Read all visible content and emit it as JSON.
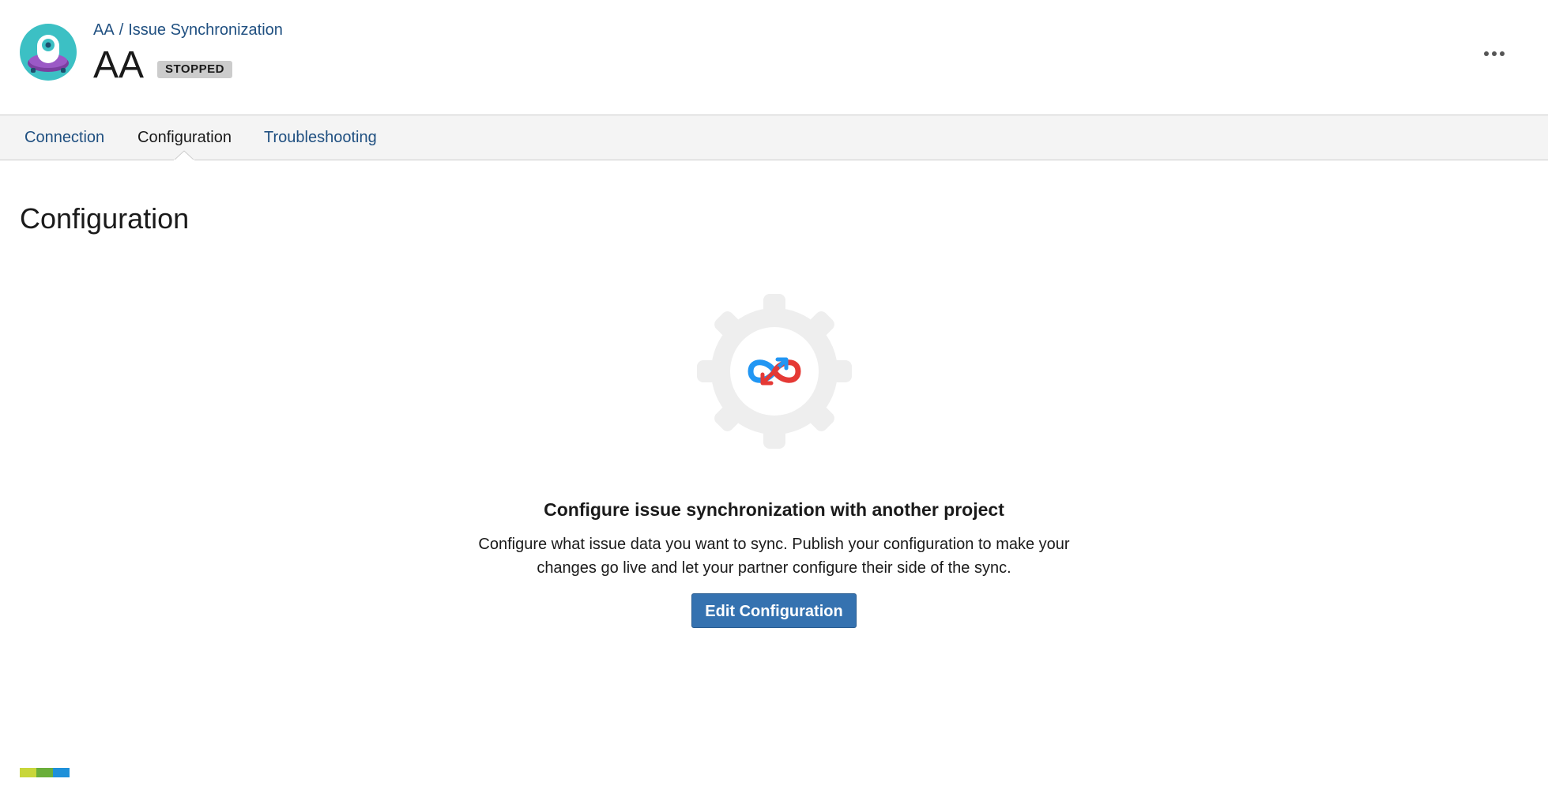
{
  "header": {
    "breadcrumb": {
      "project": "AA",
      "separator": "/",
      "section": "Issue Synchronization"
    },
    "title": "AA",
    "status": "STOPPED",
    "more_icon": "ellipsis-icon",
    "avatar_icon": "project-avatar-icon"
  },
  "tabs": [
    {
      "label": "Connection",
      "active": false
    },
    {
      "label": "Configuration",
      "active": true
    },
    {
      "label": "Troubleshooting",
      "active": false
    }
  ],
  "main": {
    "title": "Configuration",
    "empty_state": {
      "icon": "gear-sync-icon",
      "heading": "Configure issue synchronization with another project",
      "description": "Configure what issue data you want to sync. Publish your configuration to make your changes go live and let your partner configure their side of the sync.",
      "button_label": "Edit Configuration"
    }
  },
  "colors": {
    "link": "#205081",
    "primary_button": "#3572b0",
    "badge_bg": "#cccccc",
    "sync_blue": "#2196f3",
    "sync_red": "#e53935",
    "footer_logo": [
      "#c8d63a",
      "#6aae3a",
      "#1e90d9"
    ]
  }
}
